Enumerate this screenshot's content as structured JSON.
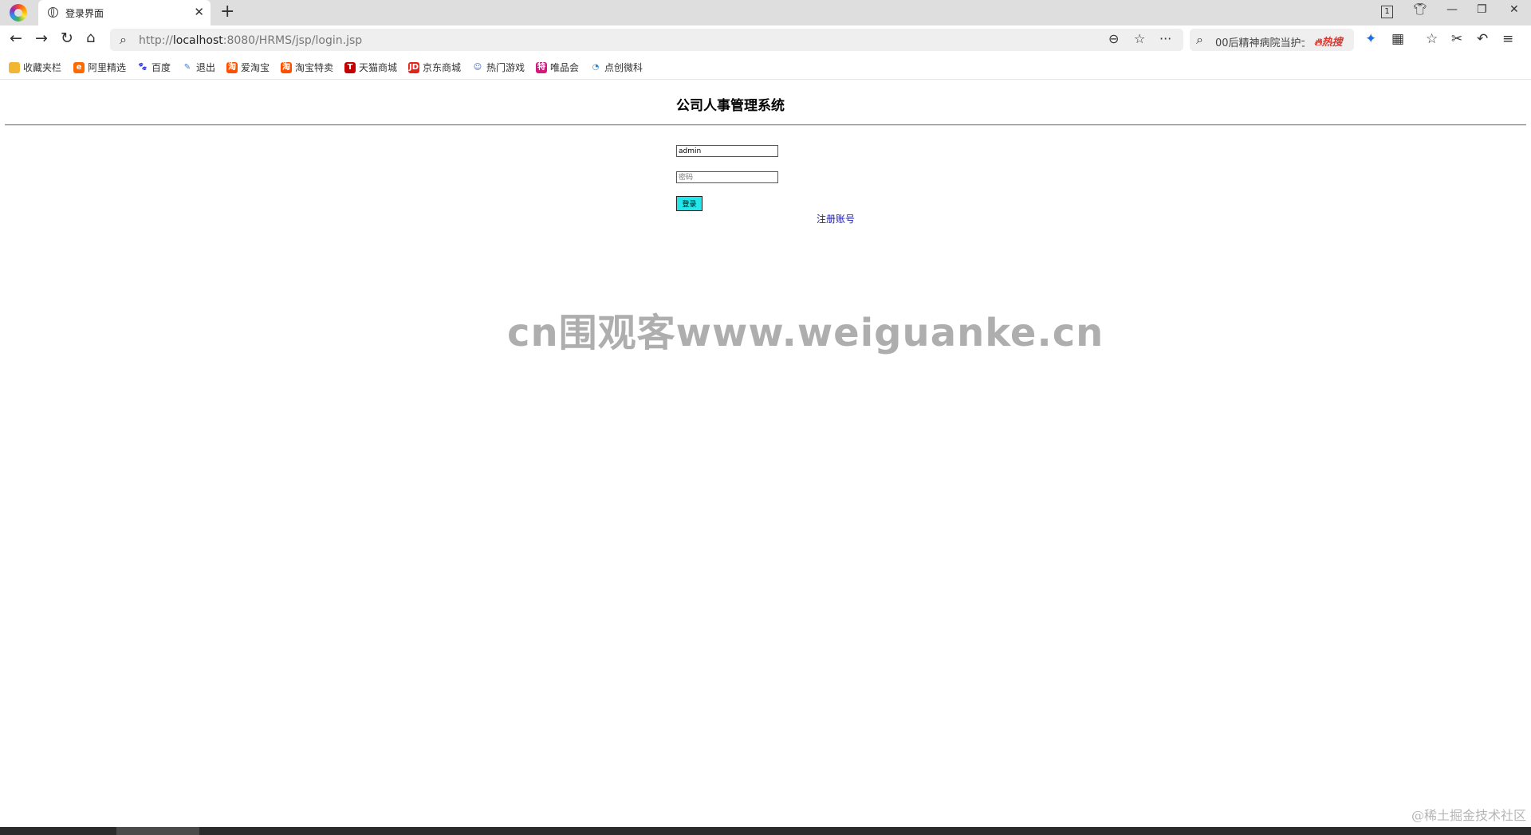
{
  "browser": {
    "tab_title": "登录界面",
    "tab_count": "1",
    "url_scheme": "http://",
    "url_host": "localhost",
    "url_path": ":8080/HRMS/jsp/login.jsp",
    "search_text": "00后精神病院当护士",
    "hot_badge": "热搜"
  },
  "bookmarks": [
    {
      "label": "收藏夹栏",
      "icon": "folder-icon",
      "color": "#f2b632"
    },
    {
      "label": "阿里精选",
      "icon": "ali-icon",
      "color": "#ff6a00"
    },
    {
      "label": "百度",
      "icon": "baidu-icon",
      "color": "#2932e1"
    },
    {
      "label": "退出",
      "icon": "feather-icon",
      "color": "#3b7dd8"
    },
    {
      "label": "爱淘宝",
      "icon": "taobao-icon",
      "color": "#ff5000"
    },
    {
      "label": "淘宝特卖",
      "icon": "taobao-icon",
      "color": "#ff5000"
    },
    {
      "label": "天猫商城",
      "icon": "tmall-icon",
      "color": "#c40000"
    },
    {
      "label": "京东商城",
      "icon": "jd-icon",
      "color": "#e1251b"
    },
    {
      "label": "热门游戏",
      "icon": "game-icon",
      "color": "#3a66c4"
    },
    {
      "label": "唯品会",
      "icon": "vip-icon",
      "color": "#d21a7e"
    },
    {
      "label": "点创微科",
      "icon": "wave-icon",
      "color": "#1e88e5"
    }
  ],
  "page": {
    "title": "公司人事管理系统",
    "username_value": "admin",
    "password_placeholder": "密码",
    "login_label": "登录",
    "register_label": "注册账号"
  },
  "watermark": "cn围观客www.weiguanke.cn",
  "corner_watermark": "@稀土掘金技术社区"
}
